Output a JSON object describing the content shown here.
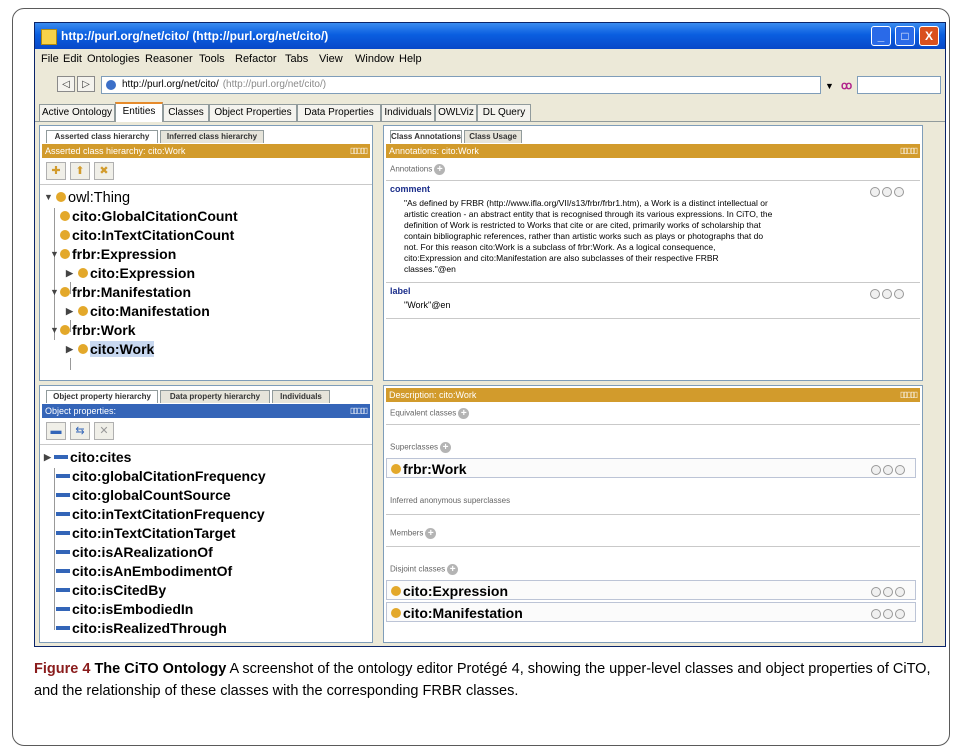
{
  "window": {
    "title": "http://purl.org/net/cito/ (http://purl.org/net/cito/)",
    "buttons": [
      "_",
      "□",
      "X"
    ]
  },
  "menu": [
    "File",
    "Edit",
    "Ontologies",
    "Reasoner",
    "Tools",
    "Refactor",
    "Tabs",
    "View",
    "Window",
    "Help"
  ],
  "address": {
    "back": "◁",
    "forward": "▷",
    "url": "http://purl.org/net/cito/",
    "url_sub": "(http://purl.org/net/cito/)",
    "dropdown": "▼",
    "find_icon": "ꝏ"
  },
  "tabs": [
    "Active Ontology",
    "Entities",
    "Classes",
    "Object Properties",
    "Data Properties",
    "Individuals",
    "OWLViz",
    "DL Query"
  ],
  "active_tab": "Entities",
  "class_panel": {
    "tabs": [
      "Asserted class hierarchy",
      "Inferred class hierarchy"
    ],
    "header": "Asserted class hierarchy: cito:Work",
    "header_ctrls": "▯▯▯▯▯",
    "tool_icons": [
      "add-subclass-icon",
      "add-sibling-icon",
      "delete-class-icon"
    ],
    "tool_glyphs": [
      "✚",
      "⬆",
      "✖"
    ],
    "tree": [
      {
        "label": "owl:Thing",
        "expander": "▼"
      },
      {
        "label": "cito:GlobalCitationCount",
        "expander": ""
      },
      {
        "label": "cito:InTextCitationCount",
        "expander": ""
      },
      {
        "label": "frbr:Expression",
        "expander": "▼"
      },
      {
        "label": "cito:Expression",
        "expander": "▶"
      },
      {
        "label": "frbr:Manifestation",
        "expander": "▼"
      },
      {
        "label": "cito:Manifestation",
        "expander": "▶"
      },
      {
        "label": "frbr:Work",
        "expander": "▼"
      },
      {
        "label": "cito:Work",
        "expander": "▶"
      }
    ]
  },
  "prop_panel": {
    "tabs": [
      "Object property hierarchy",
      "Data property hierarchy",
      "Individuals"
    ],
    "header": "Object properties:",
    "header_ctrls": "▯▯▯▯▯",
    "tool_icons": [
      "add-subproperty-icon",
      "add-sibling-property-icon",
      "delete-property-icon"
    ],
    "tool_glyphs": [
      "▬",
      "⇆",
      "✕"
    ],
    "items": [
      {
        "label": "cito:cites",
        "expander": "▶"
      },
      {
        "label": "cito:globalCitationFrequency",
        "expander": ""
      },
      {
        "label": "cito:globalCountSource",
        "expander": ""
      },
      {
        "label": "cito:inTextCitationFrequency",
        "expander": ""
      },
      {
        "label": "cito:inTextCitationTarget",
        "expander": ""
      },
      {
        "label": "cito:isARealizationOf",
        "expander": ""
      },
      {
        "label": "cito:isAnEmbodimentOf",
        "expander": ""
      },
      {
        "label": "cito:isCitedBy",
        "expander": ""
      },
      {
        "label": "cito:isEmbodiedIn",
        "expander": ""
      },
      {
        "label": "cito:isRealizedThrough",
        "expander": ""
      }
    ]
  },
  "annotation_panel": {
    "tabs": [
      "Class Annotations",
      "Class Usage"
    ],
    "header": "Annotations: cito:Work",
    "header_ctrls": "▯▯▯▯▯",
    "section": "Annotations",
    "plus": "+",
    "comment_key": "comment",
    "comment_lines": [
      "\"As defined by FRBR (http://www.ifla.org/VII/s13/frbr/frbr1.htm), a Work is a distinct intellectual or",
      "artistic creation - an abstract entity that is recognised through its various expressions.  In CiTO, the",
      "definition of Work is restricted to Works that cite or are cited, primarily works of scholarship that",
      "contain bibliographic references, rather than artistic works such as plays or photographs that do",
      "not.  For this reason cito:Work is a subclass of frbr:Work.  As a logical consequence,",
      "cito:Expression and cito:Manifestation are also subclasses of their respective FRBR",
      "classes.\"@en"
    ],
    "label_key": "label",
    "label_value": "\"Work\"@en"
  },
  "description_panel": {
    "header": "Description: cito:Work",
    "header_ctrls": "▯▯▯▯▯",
    "plus": "+",
    "equivalent": "Equivalent classes",
    "superclasses": "Superclasses",
    "superclass_items": [
      "frbr:Work"
    ],
    "inferred": "Inferred anonymous superclasses",
    "members": "Members",
    "disjoint": "Disjoint classes",
    "disjoint_items": [
      "cito:Expression",
      "cito:Manifestation"
    ]
  },
  "caption": {
    "fig": "Figure 4",
    "title": "The CiTO Ontology",
    "text": " A screenshot of the ontology editor Protégé 4, showing the upper-level classes and object properties of CiTO, and the relationship of these classes with the corresponding FRBR classes."
  },
  "colors": {
    "titlebar": "#0a5ee0",
    "view_header": "#d29b2c",
    "class_dot": "#e3a82a",
    "property_bar": "#3365b8",
    "figure_label": "#8a1c1c"
  }
}
